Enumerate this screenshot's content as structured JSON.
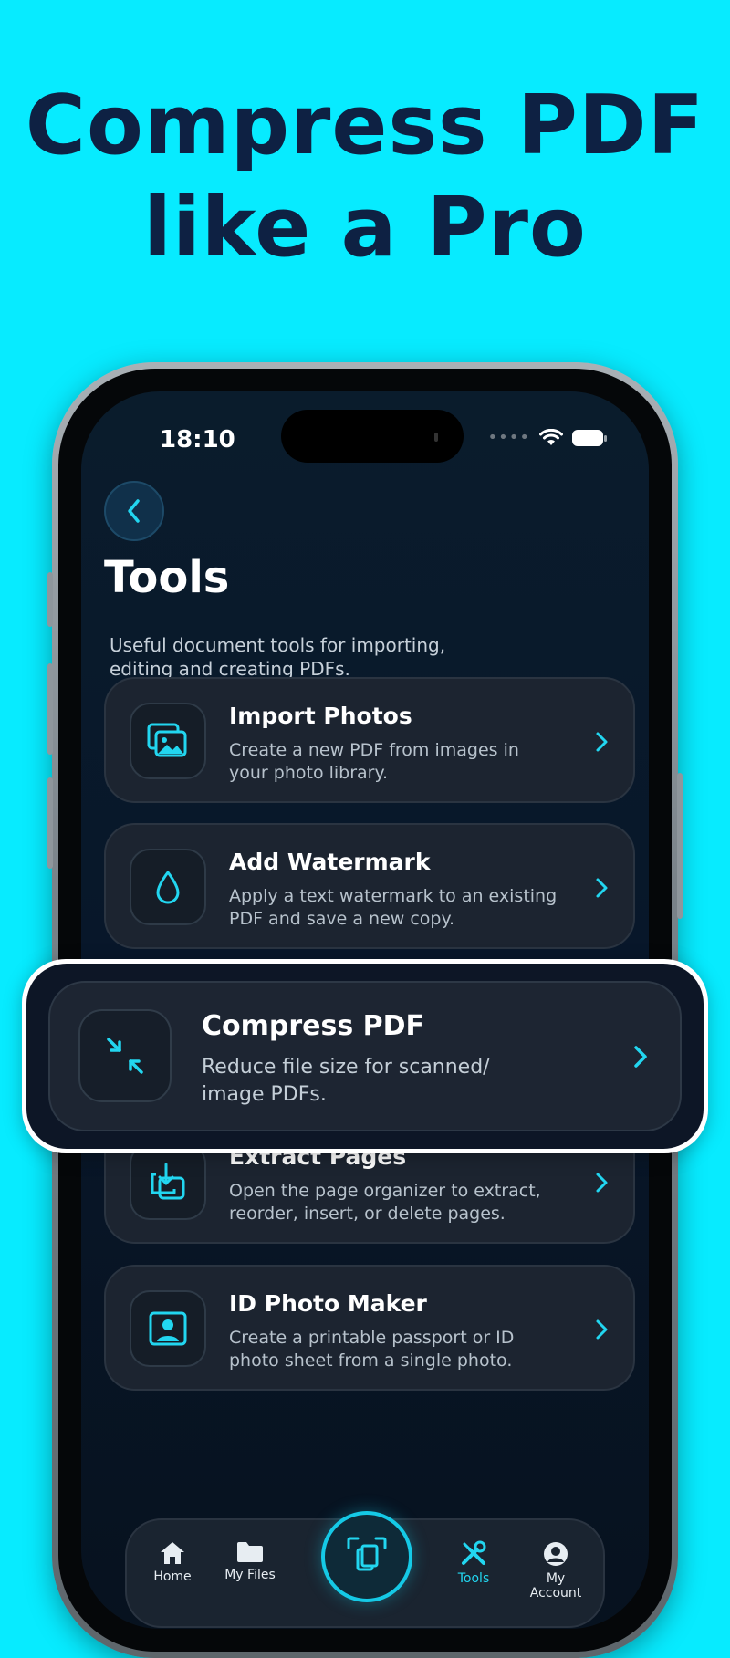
{
  "headline": {
    "line1": "Compress PDF",
    "line2": "like a Pro"
  },
  "status_bar": {
    "time": "18:10",
    "dots": "••••"
  },
  "page": {
    "title": "Tools",
    "subtitle": "Useful document tools for importing, editing and creating PDFs."
  },
  "tools": [
    {
      "title": "Import Photos",
      "desc": "Create a new PDF from images in your photo library.",
      "icon": "photos-icon"
    },
    {
      "title": "Add Watermark",
      "desc": "Apply a text watermark to an existing PDF and save a new copy.",
      "icon": "droplet-icon"
    },
    {
      "title": "Compress PDF",
      "desc": "Reduce file size for scanned/ image PDFs.",
      "icon": "compress-icon"
    },
    {
      "title": "Extract Pages",
      "desc": "Open the page organizer to extract, reorder, insert, or delete pages.",
      "icon": "extract-icon"
    },
    {
      "title": "ID Photo Maker",
      "desc": "Create a printable passport or ID photo sheet from a single photo.",
      "icon": "id-photo-icon"
    }
  ],
  "tabbar": {
    "items": [
      {
        "label": "Home",
        "icon": "home-icon"
      },
      {
        "label": "My Files",
        "icon": "folder-icon"
      },
      {
        "label": "Tools",
        "icon": "tools-icon"
      },
      {
        "label": "My Account",
        "icon": "account-icon"
      }
    ],
    "fab_icon": "scan-icon"
  },
  "colors": {
    "background": "#07EBFF",
    "headline": "#0E2143",
    "accent": "#22D6F0"
  }
}
